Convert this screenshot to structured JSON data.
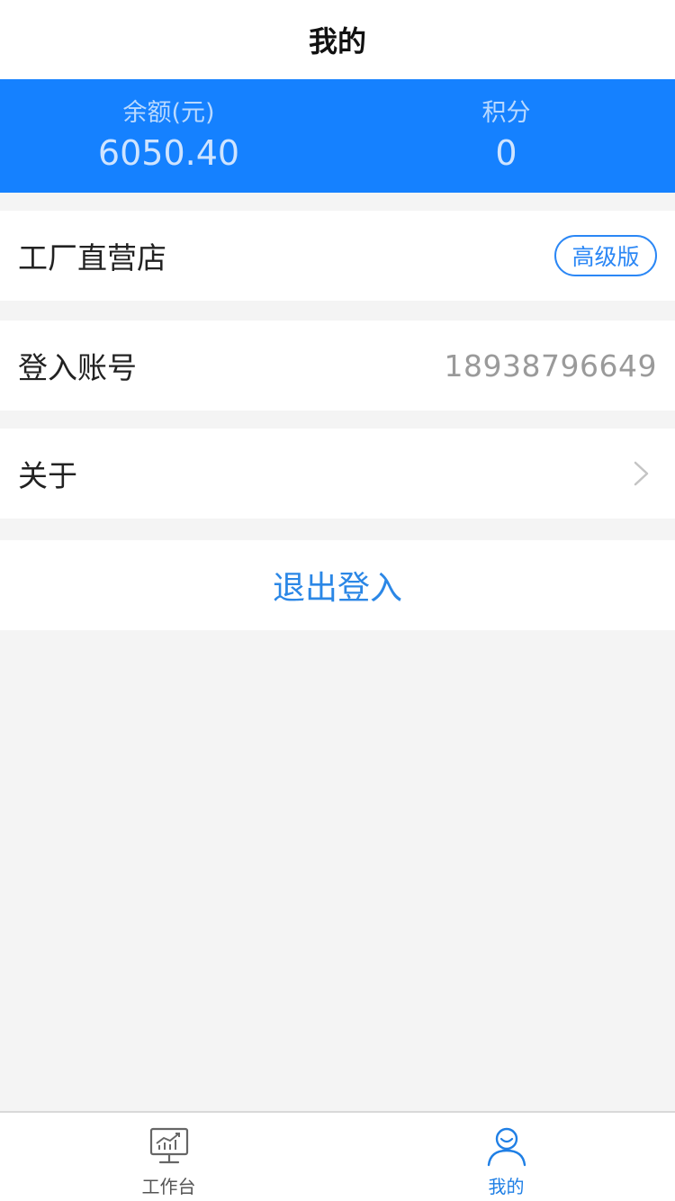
{
  "header": {
    "title": "我的"
  },
  "stats": {
    "balance": {
      "label": "余额(元)",
      "value": "6050.40"
    },
    "points": {
      "label": "积分",
      "value": "0"
    }
  },
  "store": {
    "name": "工厂直营店",
    "badge": "高级版"
  },
  "account": {
    "label": "登入账号",
    "value": "18938796649"
  },
  "about": {
    "label": "关于"
  },
  "logout": {
    "label": "退出登入"
  },
  "tabbar": {
    "items": [
      {
        "label": "工作台",
        "icon": "dashboard-chart-icon",
        "active": false
      },
      {
        "label": "我的",
        "icon": "user-profile-icon",
        "active": true
      }
    ]
  },
  "colors": {
    "accent": "#1581ff",
    "link": "#2b87e6",
    "background": "#f4f4f4"
  }
}
